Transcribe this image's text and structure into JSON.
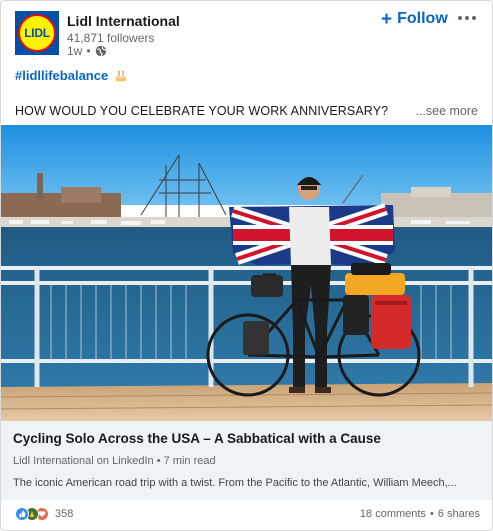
{
  "header": {
    "logo_text": "LIDL",
    "company_name": "Lidl International",
    "followers": "41,871 followers",
    "time_ago": "1w",
    "separator": "•",
    "follow_label": "Follow",
    "follow_icon": "+"
  },
  "post": {
    "hashtag": "#lidllifebalance",
    "text": "HOW WOULD YOU CELEBRATE YOUR WORK ANNIVERSARY?",
    "see_more": "...see more"
  },
  "article": {
    "title": "Cycling Solo Across the USA – A Sabbatical with a Cause",
    "source": "Lidl International on LinkedIn • 7 min read",
    "description": "The iconic American road trip with a twist. From the Pacific to the Atlantic, William Meech,..."
  },
  "social": {
    "reaction_count": "358",
    "comments": "18 comments",
    "dot": "•",
    "shares": "6 shares",
    "reaction_icons": [
      "like-icon",
      "celebrate-icon",
      "love-icon"
    ]
  },
  "colors": {
    "brand_blue": "#0a66c2",
    "lidl_blue": "#0050aa",
    "lidl_yellow": "#fff200",
    "lidl_red": "#e60a14",
    "article_bg": "#eef3f8"
  }
}
